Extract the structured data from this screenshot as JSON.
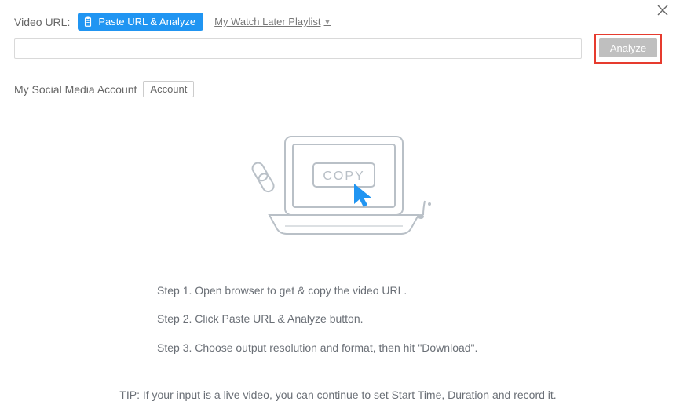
{
  "header": {
    "video_url_label": "Video URL:",
    "paste_button": "Paste URL & Analyze",
    "watch_later": "My Watch Later Playlist"
  },
  "url_row": {
    "input_value": "",
    "analyze_button": "Analyze"
  },
  "social": {
    "label": "My Social Media Account",
    "account_button": "Account"
  },
  "illustration": {
    "copy_text": "COPY"
  },
  "steps": {
    "s1": "Step 1. Open browser to get & copy the video URL.",
    "s2": "Step 2. Click Paste URL & Analyze button.",
    "s3": "Step 3. Choose output resolution and format, then hit \"Download\"."
  },
  "tip": "TIP: If your input is a live video, you can continue to set Start Time, Duration and record it."
}
